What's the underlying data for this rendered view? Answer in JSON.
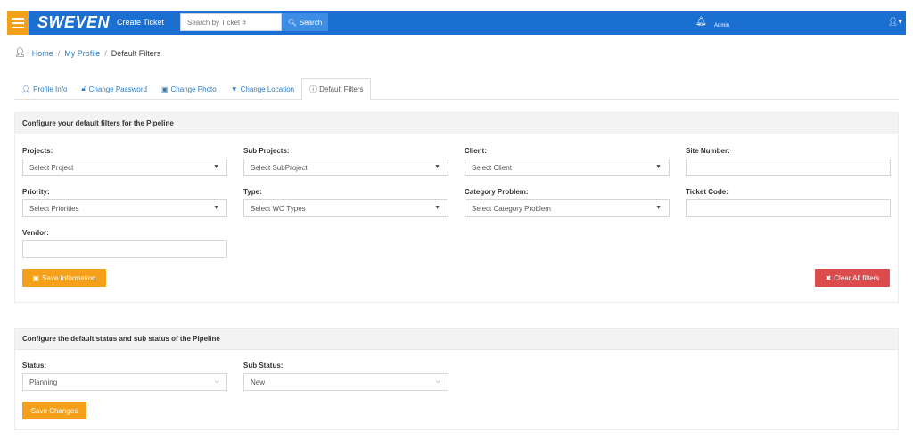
{
  "topbar": {
    "logo": "SWEVEN",
    "create_ticket": "Create Ticket",
    "search_placeholder": "Search by Ticket #",
    "search_button": "Search",
    "user_name": "Admin",
    "bell_icon": "bell-icon",
    "user_icon": "user-icon"
  },
  "breadcrumb": {
    "home": "Home",
    "sep": "/",
    "my_profile": "My Profile",
    "current": "Default Filters"
  },
  "tabs": [
    {
      "label": "Profile Info",
      "icon": "user-icon"
    },
    {
      "label": "Change Password",
      "icon": "unlock-icon"
    },
    {
      "label": "Change Photo",
      "icon": "picture-icon"
    },
    {
      "label": "Change Location",
      "icon": "map-marker-icon"
    },
    {
      "label": "Default Filters",
      "icon": "info-circle-icon",
      "active": true
    }
  ],
  "filters_panel": {
    "heading": "Configure your default filters for the Pipeline",
    "projects": {
      "label": "Projects:",
      "value": "Select Project"
    },
    "sub_projects": {
      "label": "Sub Projects:",
      "value": "Select SubProject"
    },
    "client": {
      "label": "Client:",
      "value": "Select Client"
    },
    "site_number": {
      "label": "Site Number:",
      "value": ""
    },
    "priority": {
      "label": "Priority:",
      "value": "Select Priorities"
    },
    "type": {
      "label": "Type:",
      "value": "Select WO Types"
    },
    "category_problem": {
      "label": "Category Problem:",
      "value": "Select Category Problem"
    },
    "ticket_code": {
      "label": "Ticket Code:",
      "value": ""
    },
    "vendor": {
      "label": "Vendor:",
      "value": ""
    },
    "save_button": "Save Information",
    "clear_button": "Clear All filters"
  },
  "status_panel": {
    "heading": "Configure the default status and sub status of the Pipeline",
    "status": {
      "label": "Status:",
      "value": "Planning"
    },
    "sub_status": {
      "label": "Sub Status:",
      "value": "New"
    },
    "save_button": "Save Changes"
  },
  "colors": {
    "topbar": "#1b6fd0",
    "accent_orange": "#f5a01a",
    "danger_red": "#dc4c4c",
    "link": "#337ab7"
  }
}
